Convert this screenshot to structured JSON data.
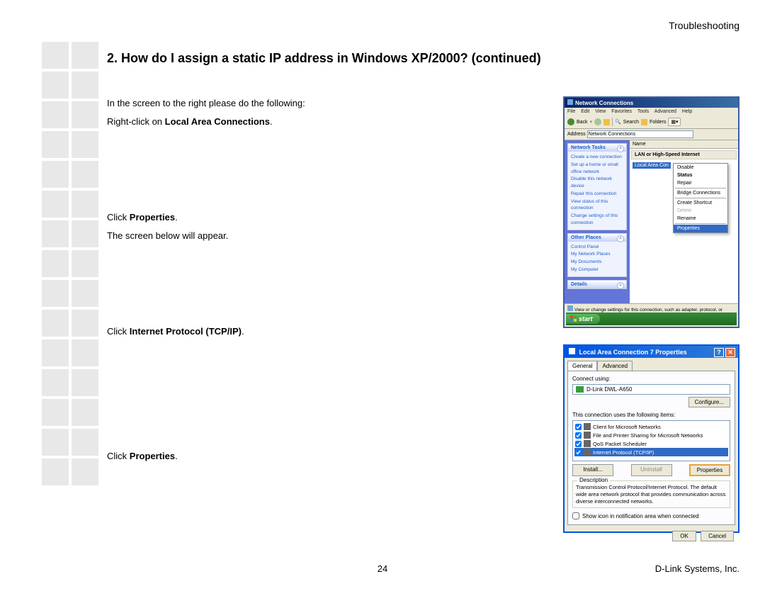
{
  "header": {
    "section": "Troubleshooting",
    "title": "2. How do I assign a static IP address in Windows XP/2000? (continued)"
  },
  "body": {
    "intro": "In the screen to the right please do the following:",
    "step1_pre": "Right-click on ",
    "step1_b": "Local Area Connections",
    "step1_post": ".",
    "step2_pre": "Click ",
    "step2_b": "Properties",
    "step2_post": ".",
    "step2_note": "The screen below will appear.",
    "step3_pre": "Click ",
    "step3_b": "Internet Protocol  (TCP/IP)",
    "step3_post": ".",
    "step4_pre": "Click ",
    "step4_b": "Properties",
    "step4_post": "."
  },
  "footer": {
    "page": "24",
    "company": "D-Link Systems, Inc."
  },
  "shot1": {
    "title": "Network Connections",
    "menu": [
      "File",
      "Edit",
      "View",
      "Favorites",
      "Tools",
      "Advanced",
      "Help"
    ],
    "toolbar": {
      "back": "Back",
      "search": "Search",
      "folders": "Folders"
    },
    "address_label": "Address",
    "address_value": "Network Connections",
    "panel1": {
      "title": "Network Tasks",
      "items": [
        "Create a new connection",
        "Set up a home or small office network",
        "Disable this network device",
        "Repair this connection",
        "View status of this connection",
        "Change settings of this connection"
      ]
    },
    "panel2": {
      "title": "Other Places",
      "items": [
        "Control Panel",
        "My Network Places",
        "My Documents",
        "My Computer"
      ]
    },
    "panel3": {
      "title": "Details"
    },
    "col_name": "Name",
    "category": "LAN or High-Speed Internet",
    "item": "Local Area Con",
    "ctx": [
      "Disable",
      "Status",
      "Repair",
      "Bridge Connections",
      "Create Shortcut",
      "Delete",
      "Rename",
      "Properties"
    ],
    "status": "View or change settings for this connection, such as adapter, protocol, or modem configur",
    "start": "start"
  },
  "shot2": {
    "title": "Local Area Connection 7 Properties",
    "tabs": [
      "General",
      "Advanced"
    ],
    "connect_label": "Connect using:",
    "adapter": "D-Link DWL-A650",
    "configure": "Configure...",
    "items_label": "This connection uses the following items:",
    "items": [
      "Client for Microsoft Networks",
      "File and Printer Sharing for Microsoft Networks",
      "QoS Packet Scheduler",
      "Internet Protocol (TCP/IP)"
    ],
    "install": "Install...",
    "uninstall": "Uninstall",
    "properties": "Properties",
    "desc_title": "Description",
    "desc": "Transmission Control Protocol/Internet Protocol. The default wide area network protocol that provides communication across diverse interconnected networks.",
    "show_icon": "Show icon in notification area when connected",
    "ok": "OK",
    "cancel": "Cancel"
  }
}
